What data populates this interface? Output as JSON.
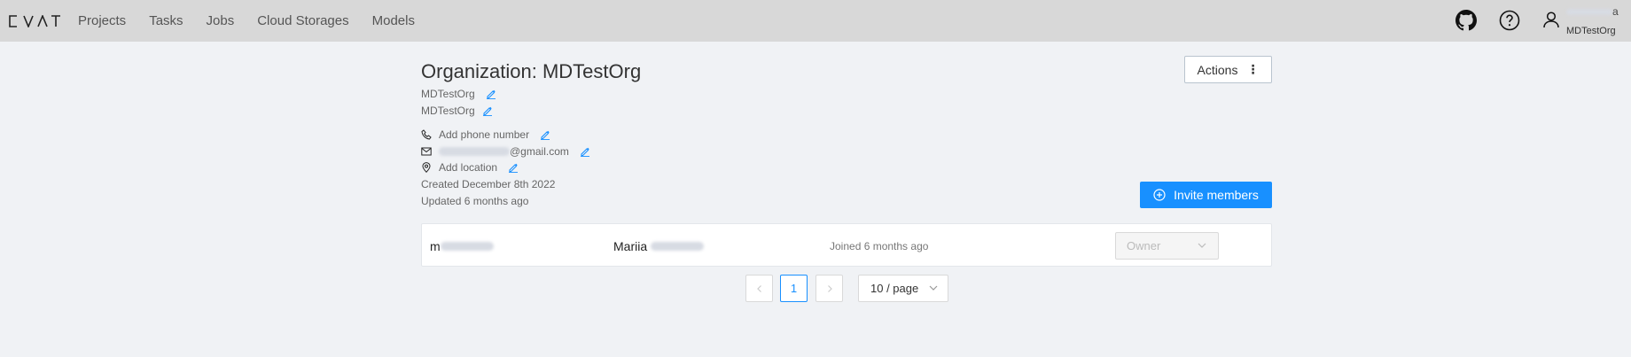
{
  "app": {
    "logo_text": "CVAT"
  },
  "nav": {
    "items": [
      "Projects",
      "Tasks",
      "Jobs",
      "Cloud Storages",
      "Models"
    ]
  },
  "header_icons": [
    "github-icon",
    "help-icon",
    "user-icon"
  ],
  "user": {
    "name_suffix": "a",
    "org": "MDTestOrg"
  },
  "organization": {
    "title": "Organization: MDTestOrg",
    "short_name": "MDTestOrg",
    "description": "MDTestOrg",
    "phone_placeholder": "Add phone number",
    "email_domain": "@gmail.com",
    "location_placeholder": "Add location",
    "created": "Created December 8th 2022",
    "updated": "Updated 6 months ago"
  },
  "buttons": {
    "actions": "Actions",
    "invite": "Invite members"
  },
  "members": [
    {
      "login_prefix": "m",
      "first_name": "Mariia",
      "joined": "Joined 6 months ago",
      "role": "Owner"
    }
  ],
  "pagination": {
    "current_page": "1",
    "page_size": "10 / page"
  },
  "colors": {
    "accent": "#1890ff",
    "header_bg": "#d8d8d8",
    "page_bg": "#f0f2f5"
  }
}
